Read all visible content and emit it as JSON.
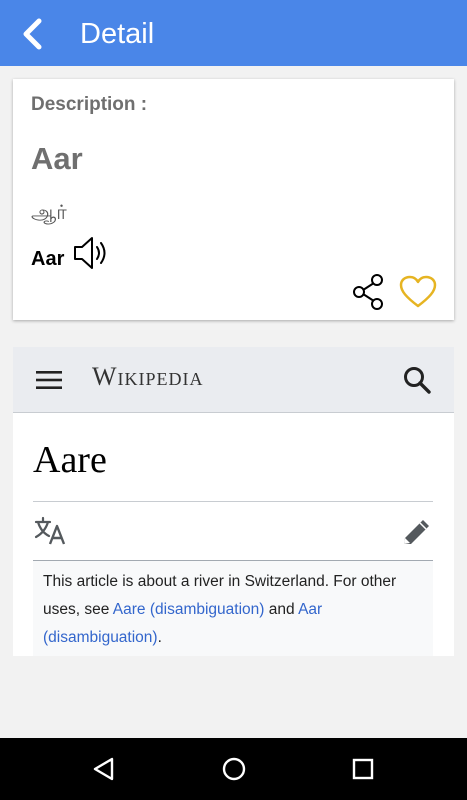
{
  "app_bar": {
    "title": "Detail"
  },
  "card": {
    "description_label": "Description :",
    "word": "Aar",
    "tamil": "ஆர்",
    "pronunciation_word": "Aar"
  },
  "wiki": {
    "logo": "Wikipedia",
    "article_title": "Aare",
    "hatnote_intro": "This article is about a river in Switzerland. For other uses, see ",
    "hatnote_link1": "Aare (disambiguation)",
    "hatnote_and": " and ",
    "hatnote_link2": "Aar (disambiguation)",
    "hatnote_end": "."
  },
  "colors": {
    "app_bar": "#4a86e8",
    "favorite": "#e6b422",
    "link": "#3366cc"
  },
  "icons": [
    "back-arrow-icon",
    "speaker-icon",
    "share-icon",
    "heart-icon",
    "menu-icon",
    "search-icon",
    "translate-icon",
    "pencil-icon",
    "nav-back-icon",
    "nav-home-icon",
    "nav-recents-icon"
  ]
}
